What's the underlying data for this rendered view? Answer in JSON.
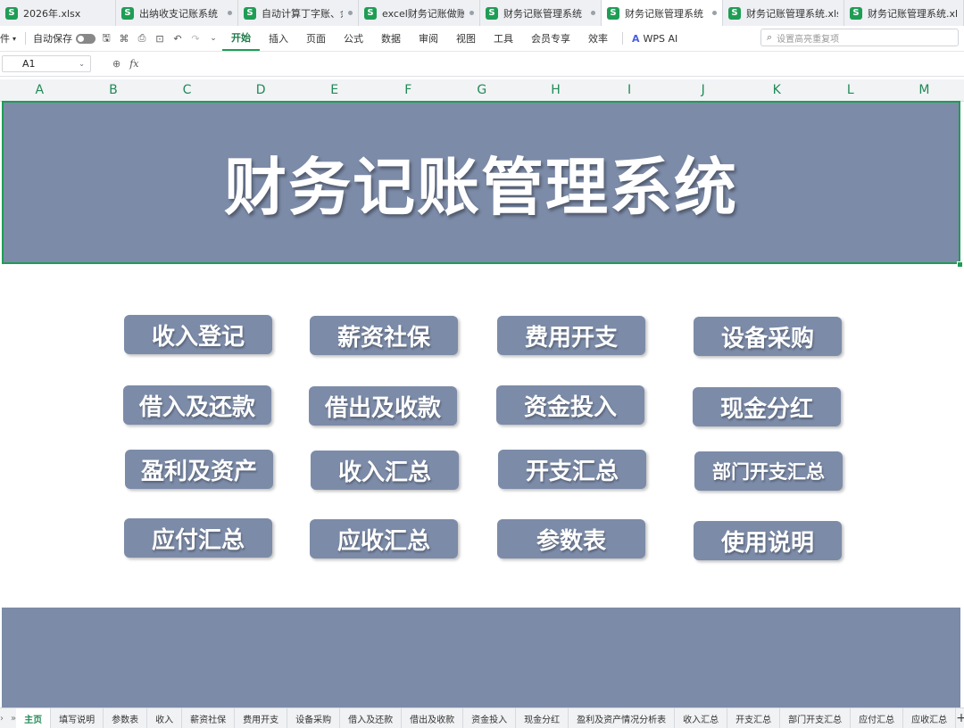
{
  "file_tabs": [
    {
      "title": "2026年.xlsx",
      "active": false,
      "modified": false
    },
    {
      "title": "出纳收支记账系统（",
      "active": false,
      "modified": true
    },
    {
      "title": "自动计算丁字账、余",
      "active": false,
      "modified": true
    },
    {
      "title": "excel财务记账做账",
      "active": false,
      "modified": true
    },
    {
      "title": "财务记账管理系统（全",
      "active": false,
      "modified": true
    },
    {
      "title": "财务记账管理系统（",
      "active": true,
      "modified": true
    },
    {
      "title": "财务记账管理系统.xls",
      "active": false,
      "modified": false
    },
    {
      "title": "财务记账管理系统.xl",
      "active": false,
      "modified": false
    }
  ],
  "file_icon_letter": "S",
  "menubar": {
    "file_label": "件",
    "autosave_label": "自动保存",
    "items": [
      "开始",
      "插入",
      "页面",
      "公式",
      "数据",
      "审阅",
      "视图",
      "工具",
      "会员专享",
      "效率"
    ],
    "active_item": "开始",
    "wps_ai_label": "WPS AI",
    "search_placeholder": "设置高亮重复项"
  },
  "formula_bar": {
    "cell_ref": "A1",
    "fx_label": "fx",
    "content": ""
  },
  "columns": [
    "A",
    "B",
    "C",
    "D",
    "E",
    "F",
    "G",
    "H",
    "I",
    "J",
    "K",
    "L",
    "M"
  ],
  "sheet": {
    "title": "财务记账管理系统",
    "buttons": [
      [
        "收入登记",
        "薪资社保",
        "费用开支",
        "设备采购"
      ],
      [
        "借入及还款",
        "借出及收款",
        "资金投入",
        "现金分红"
      ],
      [
        "盈利及资产",
        "收入汇总",
        "开支汇总",
        "部门开支汇总"
      ],
      [
        "应付汇总",
        "应收汇总",
        "参数表",
        "使用说明"
      ]
    ]
  },
  "sheet_tabs": [
    "主页",
    "填写说明",
    "参数表",
    "收入",
    "薪资社保",
    "费用开支",
    "设备采购",
    "借入及还款",
    "借出及收款",
    "资金投入",
    "现金分红",
    "盈利及资产情况分析表",
    "收入汇总",
    "开支汇总",
    "部门开支汇总",
    "应付汇总",
    "应收汇总"
  ],
  "active_sheet_tab": "主页",
  "colors": {
    "accent_green": "#1f9d55",
    "banner_fill": "#7c8ba8"
  }
}
